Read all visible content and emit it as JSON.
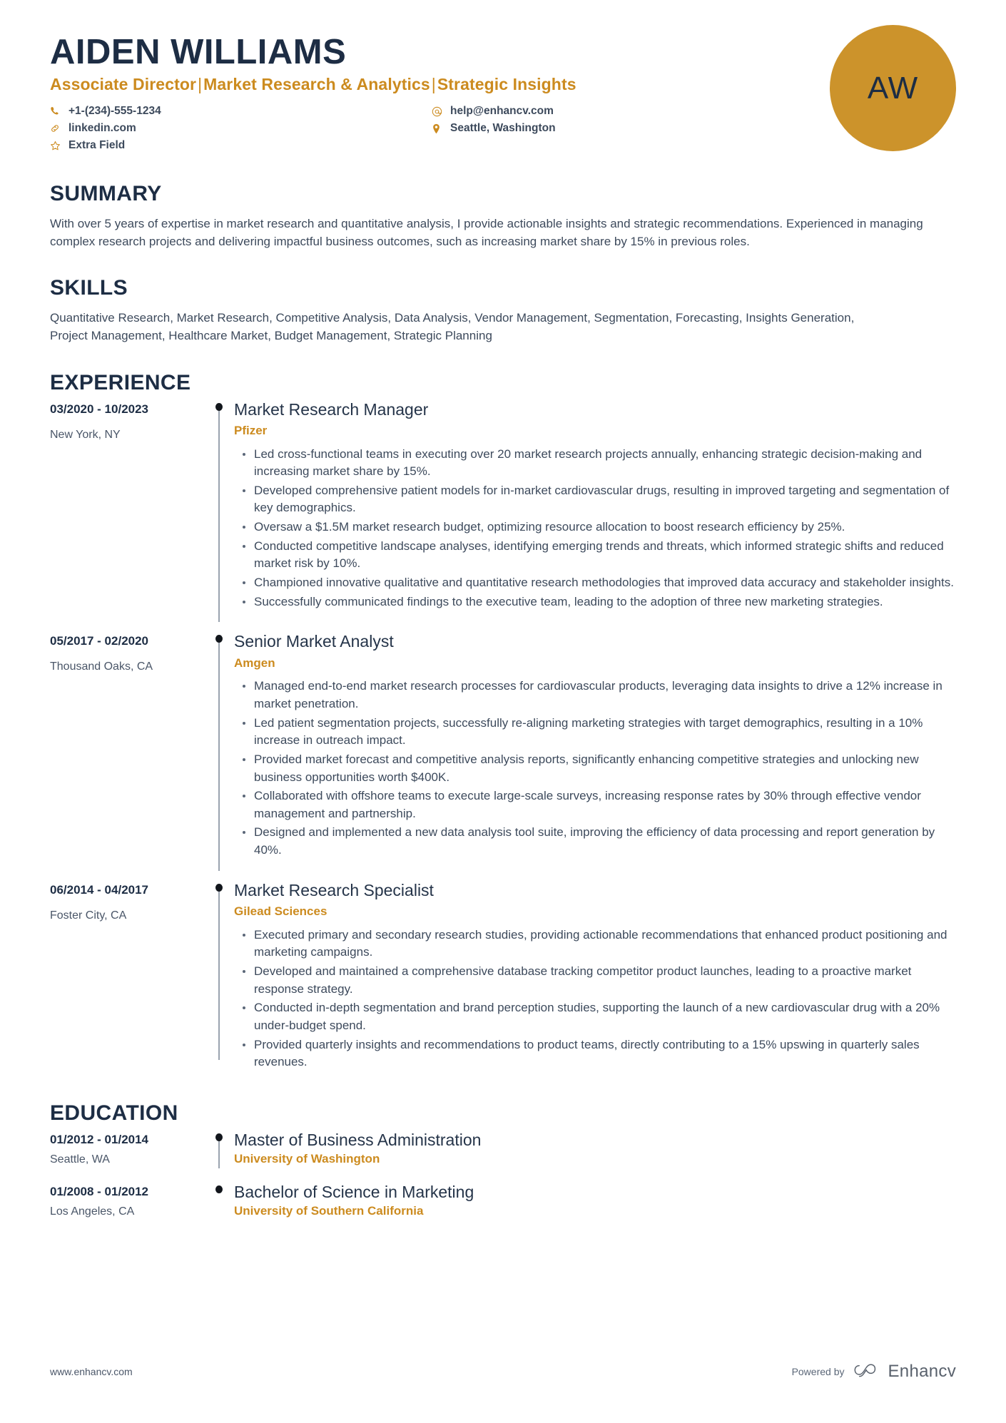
{
  "header": {
    "name": "AIDEN WILLIAMS",
    "headline_parts": [
      "Associate Director",
      "Market Research & Analytics",
      "Strategic Insights"
    ],
    "headline_separator": "|",
    "avatar_initials": "AW",
    "contacts": [
      {
        "icon": "phone-icon",
        "value": "+1-(234)-555-1234"
      },
      {
        "icon": "email-icon",
        "value": "help@enhancv.com"
      },
      {
        "icon": "link-icon",
        "value": "linkedin.com"
      },
      {
        "icon": "location-icon",
        "value": "Seattle, Washington"
      },
      {
        "icon": "star-icon",
        "value": "Extra Field"
      }
    ]
  },
  "summary": {
    "title": "SUMMARY",
    "text": "With over 5 years of expertise in market research and quantitative analysis, I provide actionable insights and strategic recommendations. Experienced in managing complex research projects and delivering impactful business outcomes, such as increasing market share by 15% in previous roles."
  },
  "skills": {
    "title": "SKILLS",
    "text": "Quantitative Research, Market Research, Competitive Analysis, Data Analysis, Vendor Management, Segmentation, Forecasting, Insights Generation, Project Management, Healthcare Market, Budget Management, Strategic Planning"
  },
  "experience": {
    "title": "EXPERIENCE",
    "entries": [
      {
        "date": "03/2020 - 10/2023",
        "location": "New York, NY",
        "title": "Market Research Manager",
        "org": "Pfizer",
        "bullets": [
          "Led cross-functional teams in executing over 20 market research projects annually, enhancing strategic decision-making and increasing market share by 15%.",
          "Developed comprehensive patient models for in-market cardiovascular drugs, resulting in improved targeting and segmentation of key demographics.",
          "Oversaw a $1.5M market research budget, optimizing resource allocation to boost research efficiency by 25%.",
          "Conducted competitive landscape analyses, identifying emerging trends and threats, which informed strategic shifts and reduced market risk by 10%.",
          "Championed innovative qualitative and quantitative research methodologies that improved data accuracy and stakeholder insights.",
          "Successfully communicated findings to the executive team, leading to the adoption of three new marketing strategies."
        ]
      },
      {
        "date": "05/2017 - 02/2020",
        "location": "Thousand Oaks, CA",
        "title": "Senior Market Analyst",
        "org": "Amgen",
        "bullets": [
          "Managed end-to-end market research processes for cardiovascular products, leveraging data insights to drive a 12% increase in market penetration.",
          "Led patient segmentation projects, successfully re-aligning marketing strategies with target demographics, resulting in a 10% increase in outreach impact.",
          "Provided market forecast and competitive analysis reports, significantly enhancing competitive strategies and unlocking new business opportunities worth $400K.",
          "Collaborated with offshore teams to execute large-scale surveys, increasing response rates by 30% through effective vendor management and partnership.",
          "Designed and implemented a new data analysis tool suite, improving the efficiency of data processing and report generation by 40%."
        ]
      },
      {
        "date": "06/2014 - 04/2017",
        "location": "Foster City, CA",
        "title": "Market Research Specialist",
        "org": "Gilead Sciences",
        "bullets": [
          "Executed primary and secondary research studies, providing actionable recommendations that enhanced product positioning and marketing campaigns.",
          "Developed and maintained a comprehensive database tracking competitor product launches, leading to a proactive market response strategy.",
          "Conducted in-depth segmentation and brand perception studies, supporting the launch of a new cardiovascular drug with a 20% under-budget spend.",
          "Provided quarterly insights and recommendations to product teams, directly contributing to a 15% upswing in quarterly sales revenues."
        ]
      }
    ]
  },
  "education": {
    "title": "EDUCATION",
    "entries": [
      {
        "date": "01/2012 - 01/2014",
        "location": "Seattle, WA",
        "title": "Master of Business Administration",
        "org": "University of Washington"
      },
      {
        "date": "01/2008 - 01/2012",
        "location": "Los Angeles, CA",
        "title": "Bachelor of Science in Marketing",
        "org": "University of Southern California"
      }
    ]
  },
  "footer": {
    "website": "www.enhancv.com",
    "powered_by": "Powered by",
    "brand": "Enhancv"
  },
  "colors": {
    "accent": "#cc8b1f",
    "avatar": "#cc932b",
    "dark": "#1d2d44",
    "body": "#3d4a5c"
  }
}
